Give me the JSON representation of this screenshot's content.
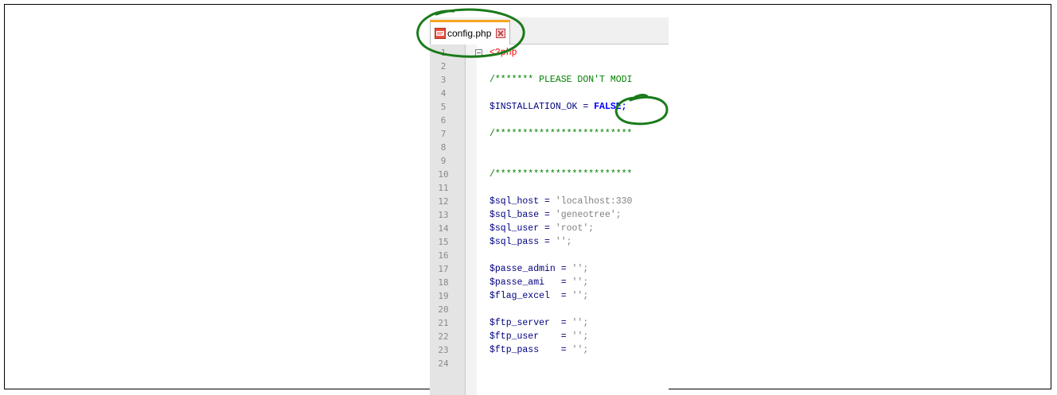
{
  "tab": {
    "filename": "config.php",
    "file_icon": "php-file-icon",
    "close_icon": "close-icon"
  },
  "lines": [
    {
      "n": "1"
    },
    {
      "n": "2"
    },
    {
      "n": "3"
    },
    {
      "n": "4"
    },
    {
      "n": "5"
    },
    {
      "n": "6"
    },
    {
      "n": "7"
    },
    {
      "n": "8"
    },
    {
      "n": "9"
    },
    {
      "n": "10"
    },
    {
      "n": "11"
    },
    {
      "n": "12"
    },
    {
      "n": "13"
    },
    {
      "n": "14"
    },
    {
      "n": "15"
    },
    {
      "n": "16"
    },
    {
      "n": "17"
    },
    {
      "n": "18"
    },
    {
      "n": "19"
    },
    {
      "n": "20"
    },
    {
      "n": "21"
    },
    {
      "n": "22"
    },
    {
      "n": "23"
    },
    {
      "n": "24"
    }
  ],
  "code": {
    "l1": "<?php",
    "l3": "/******* PLEASE DON'T MODI",
    "l5_var": "$INSTALLATION_OK",
    "l5_op": " = ",
    "l5_val": "FALSE;",
    "l7": "/*************************",
    "l10": "/*************************",
    "l12_var": "$sql_host",
    "l12_op": " = ",
    "l12_val": "'localhost:330",
    "l13_var": "$sql_base",
    "l13_op": " = ",
    "l13_val": "'geneotree';",
    "l14_var": "$sql_user",
    "l14_op": " = ",
    "l14_val": "'root';",
    "l15_var": "$sql_pass",
    "l15_op": " = ",
    "l15_val": "'';",
    "l17_var": "$passe_admin",
    "l17_op": " = ",
    "l17_val": "'';",
    "l18_var": "$passe_ami",
    "l18_op": "   = ",
    "l18_val": "'';",
    "l19_var": "$flag_excel",
    "l19_op": "  = ",
    "l19_val": "'';",
    "l21_var": "$ftp_server",
    "l21_op": "  = ",
    "l21_val": "'';",
    "l22_var": "$ftp_user",
    "l22_op": "    = ",
    "l22_val": "'';",
    "l23_var": "$ftp_pass",
    "l23_op": "    = ",
    "l23_val": "'';"
  },
  "colors": {
    "annotation": "#1a7a1a",
    "tab_accent": "#f5a623"
  }
}
